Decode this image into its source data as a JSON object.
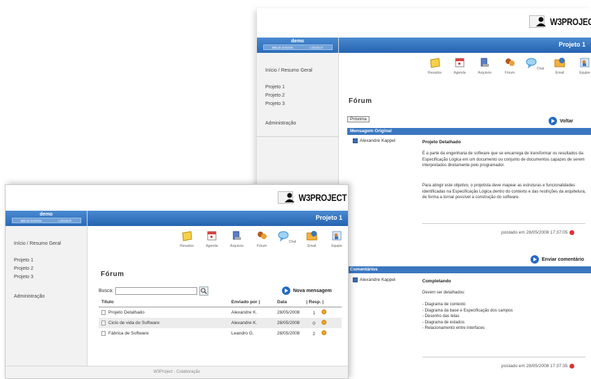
{
  "brand": {
    "name": "W3PROJECT"
  },
  "sidebar": {
    "username": "demo",
    "links": [
      "MEUS DADOS",
      "LOGOUT"
    ],
    "nav": [
      "Início / Resumo Geral",
      "Projeto 1",
      "Projeto 2",
      "Projeto 3",
      "Administração"
    ]
  },
  "project_title": "Projeto 1",
  "toolbar": [
    "Resados",
    "Agenda",
    "Arquivos",
    "Fórum",
    "Chat",
    "Email",
    "Equipe"
  ],
  "back": {
    "heading": "Fórum",
    "next_button": "Próxima",
    "back_button": "Voltar",
    "original_header": "Mensagem Original",
    "original": {
      "author": "Alexandre Kappel",
      "title": "Projeto Detalhado",
      "para1": "É a parte da engenharia de software que se encarrega de transformar os resultados da Especificação Lógica em um documento ou conjunto de documentos capazes de serem interpretados diretamente pelo programador.",
      "para2": "Para atingir este objetivo, o projetista deve mapear as estruturas e funcionalidades identificadas na Especificação Lógica dentro do contexto e das restrições da arquitetura, de forma a tornar possível a construção do software.",
      "posted": "postado em 28/05/2008 17:37:05"
    },
    "send_comment": "Enviar comentário",
    "comments_header": "Comentários",
    "comment": {
      "author": "Alexandre Kappel",
      "title": "Completando",
      "intro": "Devem ser detalhados:",
      "items": [
        "- Diagrama de contexto",
        "- Diagrama da base e Especificação dos campos",
        "- Desenho das telas",
        "- Diagrama de estados",
        "- Relacionamento entre interfaces"
      ],
      "posted": "postado em 28/05/2008 17:37:35"
    }
  },
  "front": {
    "heading": "Fórum",
    "search_label": "Busca:",
    "new_message": "Nova mensagem",
    "columns": [
      "Título",
      "Enviado por |",
      "Data",
      "| Resp. |"
    ],
    "rows": [
      {
        "title": "Projeto Detalhado",
        "by": "Alexandre K.",
        "date": "28/05/2008",
        "resp": "1"
      },
      {
        "title": "Ciclo de vida do Software",
        "by": "Alexandre K.",
        "date": "28/05/2008",
        "resp": "0"
      },
      {
        "title": "Fábrica de Software",
        "by": "Leandro G.",
        "date": "28/05/2008",
        "resp": "2"
      }
    ],
    "footer": "W3Project - Colaboração"
  },
  "colors": {
    "accent": "#2a6bb8",
    "sidebar_bg": "#f2f2f2",
    "highlight_row": "#ececec"
  },
  "icons": [
    "logo-folder-icon",
    "user-icon",
    "notes-icon",
    "calendar-icon",
    "file-icon",
    "forum-icon",
    "chat-icon",
    "email-icon",
    "team-icon",
    "next-arrow-icon",
    "search-icon",
    "document-icon",
    "star-icon",
    "delete-icon"
  ]
}
